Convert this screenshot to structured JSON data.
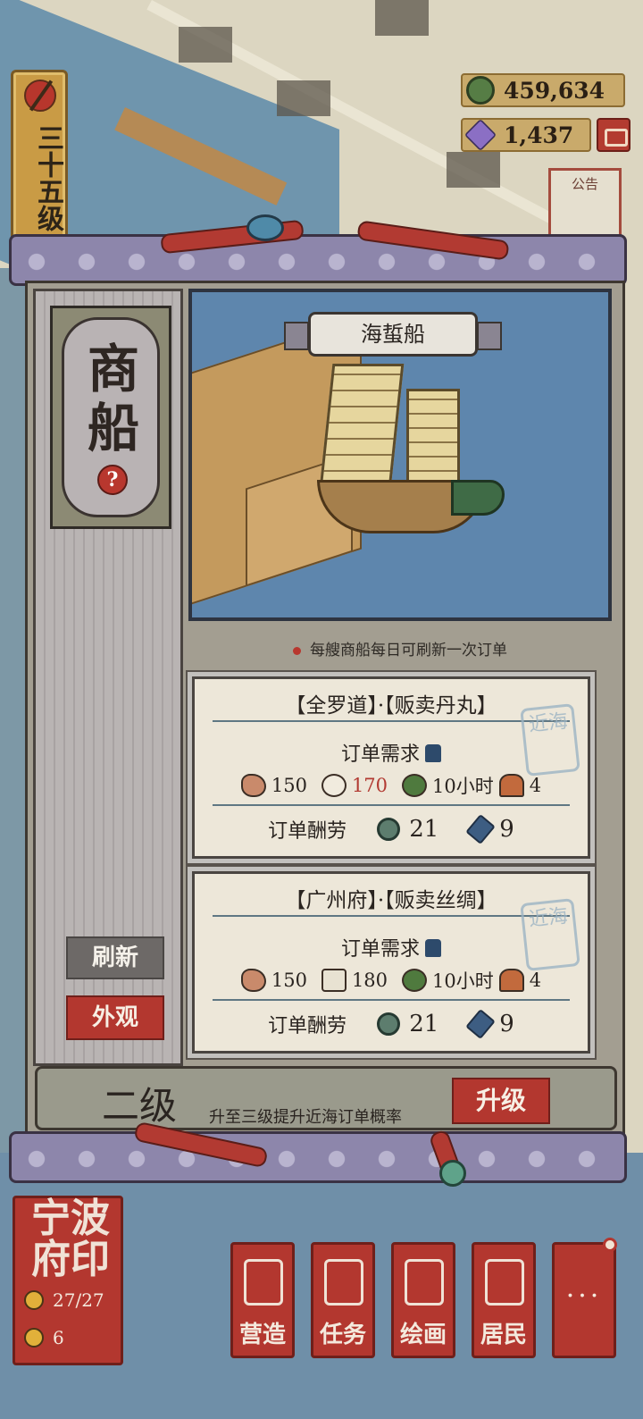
{
  "level_badge": {
    "label": "三十五级"
  },
  "currency": {
    "coins": "459,634",
    "gems": "1,437"
  },
  "notice": {
    "label": "公告"
  },
  "panel": {
    "title": "商船",
    "help": "?",
    "ship_name": "海蜇船",
    "note": "每艘商船每日可刷新一次订单",
    "refresh_label": "刷新",
    "appearance_label": "外观",
    "orders": [
      {
        "title": "【全罗道】·【贩卖丹丸】",
        "need_label": "订单需求",
        "req": {
          "fish": "150",
          "goods": "170",
          "time": "10小时",
          "workers": "4"
        },
        "reward_label": "订单酬劳",
        "reward_coin": "21",
        "reward_brush": "9",
        "stamp": "近海"
      },
      {
        "title": "【广州府】·【贩卖丝绸】",
        "need_label": "订单需求",
        "req": {
          "fish": "150",
          "goods": "180",
          "time": "10小时",
          "workers": "4"
        },
        "reward_label": "订单酬劳",
        "reward_coin": "21",
        "reward_brush": "9",
        "stamp": "近海"
      }
    ],
    "footer": {
      "level": "二级",
      "desc": "升至三级提升近海订单概率",
      "upgrade_label": "升级"
    }
  },
  "city": {
    "name": "宁波府印",
    "population": "27/27",
    "happiness": "6"
  },
  "nav": [
    {
      "label": "营造",
      "icon": "build-icon"
    },
    {
      "label": "任务",
      "icon": "task-icon"
    },
    {
      "label": "绘画",
      "icon": "scroll-icon"
    },
    {
      "label": "居民",
      "icon": "resident-icon"
    },
    {
      "label": "···",
      "icon": "more-icon"
    }
  ],
  "colors": {
    "accent_red": "#b3372f",
    "panel_grey": "#a39e91",
    "paper": "#ede7d9",
    "sea": "#5e86ad"
  }
}
